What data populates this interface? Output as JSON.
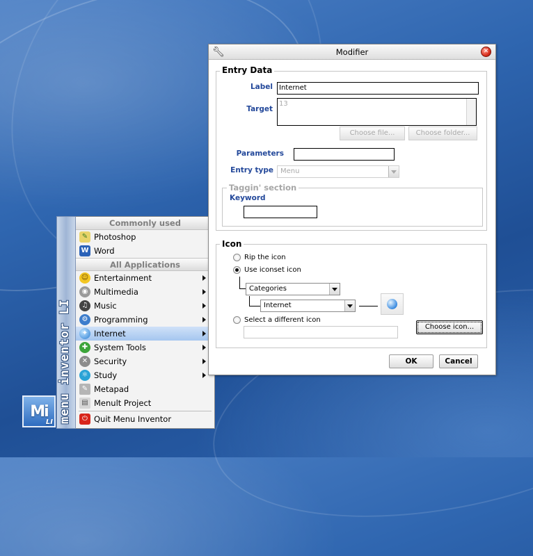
{
  "launcher": {
    "logo_text": "Mi",
    "logo_sub": "LI",
    "sidebar_text": "menu inventor LI",
    "sections": {
      "commonly_used": "Commonly used",
      "all_applications": "All Applications"
    },
    "common_items": [
      {
        "label": "Photoshop",
        "icon": "photoshop-icon"
      },
      {
        "label": "Word",
        "icon": "word-icon"
      }
    ],
    "app_items": [
      {
        "label": "Entertainment",
        "icon": "smiley-icon",
        "submenu": true
      },
      {
        "label": "Multimedia",
        "icon": "eye-icon",
        "submenu": true
      },
      {
        "label": "Music",
        "icon": "headphones-icon",
        "submenu": true
      },
      {
        "label": "Programming",
        "icon": "gear-icon",
        "submenu": true
      },
      {
        "label": "Internet",
        "icon": "globe-icon",
        "submenu": true,
        "selected": true
      },
      {
        "label": "System Tools",
        "icon": "tools-icon",
        "submenu": true
      },
      {
        "label": "Security",
        "icon": "wrench-icon",
        "submenu": true
      },
      {
        "label": "Study",
        "icon": "atom-icon",
        "submenu": true
      },
      {
        "label": "Metapad",
        "icon": "notepad-icon",
        "submenu": false
      },
      {
        "label": "Menult Project",
        "icon": "document-icon",
        "submenu": false
      }
    ],
    "quit_label": "Quit Menu Inventor"
  },
  "dialog": {
    "title": "Modifier",
    "entry_data": {
      "legend": "Entry Data",
      "label_caption": "Label",
      "label_value": "Internet",
      "target_caption": "Target",
      "target_value": "13",
      "choose_file": "Choose file...",
      "choose_folder": "Choose folder...",
      "parameters_caption": "Parameters",
      "parameters_value": "",
      "entry_type_caption": "Entry type",
      "entry_type_value": "Menu",
      "tagging_legend": "Taggin' section",
      "keyword_caption": "Keyword",
      "keyword_value": ""
    },
    "icon_section": {
      "legend": "Icon",
      "rip_label": "Rip the icon",
      "iconset_label": "Use iconset icon",
      "categories_value": "Categories",
      "internet_value": "Internet",
      "different_label": "Select a different icon",
      "choose_icon": "Choose icon...",
      "path_value": ""
    },
    "ok_label": "OK",
    "cancel_label": "Cancel"
  }
}
